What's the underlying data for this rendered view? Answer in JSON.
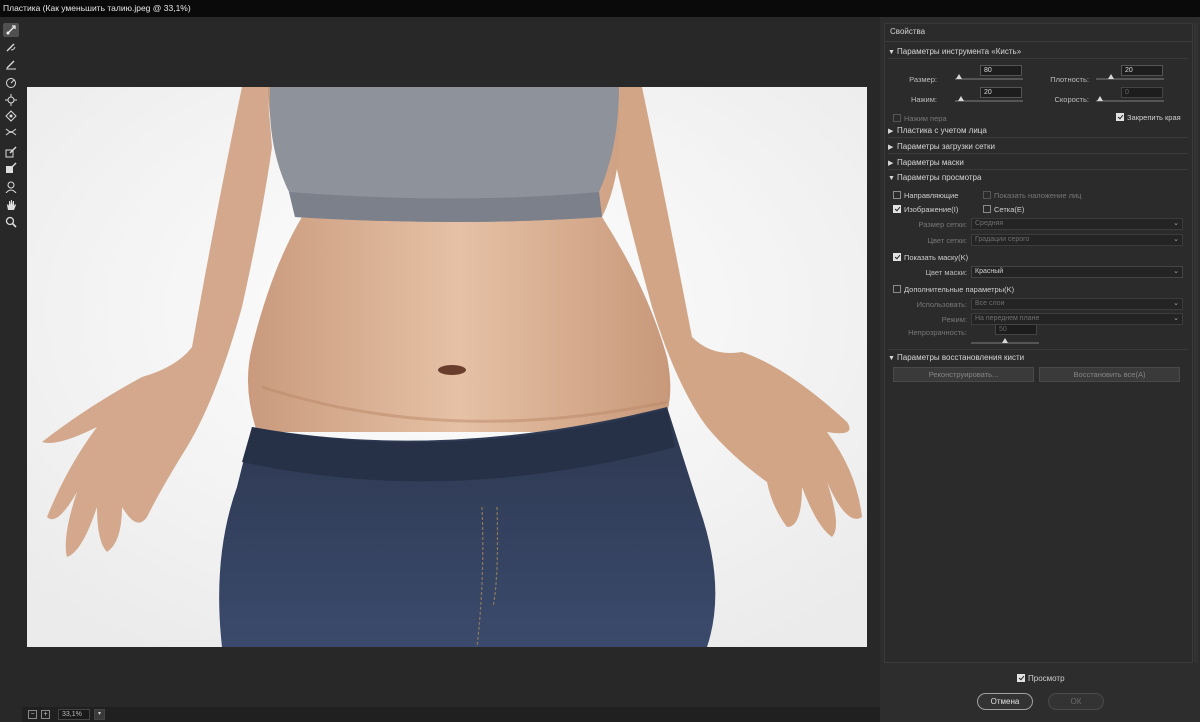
{
  "window": {
    "title": "Пластика (Как уменьшить талию.jpeg @ 33,1%)"
  },
  "tools": [
    {
      "icon": "forward-warp-icon",
      "active": true
    },
    {
      "icon": "reconstruct-icon"
    },
    {
      "icon": "smooth-icon"
    },
    {
      "icon": "twirl-clockwise-icon"
    },
    {
      "icon": "pucker-icon"
    },
    {
      "icon": "bloat-icon"
    },
    {
      "icon": "push-left-icon"
    },
    {
      "icon": "freeze-mask-icon"
    },
    {
      "icon": "thaw-mask-icon"
    },
    {
      "icon": "face-tool-icon"
    },
    {
      "icon": "hand-icon"
    },
    {
      "icon": "zoom-icon"
    }
  ],
  "status": {
    "zoom": "33,1%",
    "minus": "−",
    "plus": "+"
  },
  "panel": {
    "title": "Свойства",
    "brush": {
      "header": "Параметры инструмента «Кисть»",
      "size_label": "Размер:",
      "size": "80",
      "density_label": "Плотность:",
      "density": "20",
      "pressure_label": "Нажим:",
      "pressure": "20",
      "rate_label": "Скорость:",
      "rate": "0",
      "stylus_label": "Нажим пера",
      "pin_edges_label": "Закрепить края"
    },
    "face_aware": "Пластика с учетом лица",
    "load_mesh": "Параметры загрузки сетки",
    "mask": "Параметры маски",
    "view": {
      "header": "Параметры просмотра",
      "guides": "Направляющие",
      "face_overlay": "Показать наложение лиц",
      "image": "Изображение(I)",
      "mesh": "Сетка(E)",
      "mesh_size_label": "Размер сетки:",
      "mesh_size": "Средняя",
      "mesh_color_label": "Цвет сетки:",
      "mesh_color": "Градации серого",
      "show_mask": "Показать маску(K)",
      "mask_color_label": "Цвет маски:",
      "mask_color": "Красный",
      "backdrop": "Дополнительные параметры(K)",
      "use_label": "Использовать:",
      "use": "Все слои",
      "mode_label": "Режим:",
      "mode": "На переднем плане",
      "opacity_label": "Непрозрачность:",
      "opacity": "50"
    },
    "reconstruct": {
      "header": "Параметры восстановления кисти",
      "reconstruct_btn": "Реконструировать...",
      "restore_btn": "Восстановить все(A)"
    }
  },
  "footer": {
    "preview": "Просмотр",
    "cancel": "Отмена",
    "ok": "ОК"
  }
}
